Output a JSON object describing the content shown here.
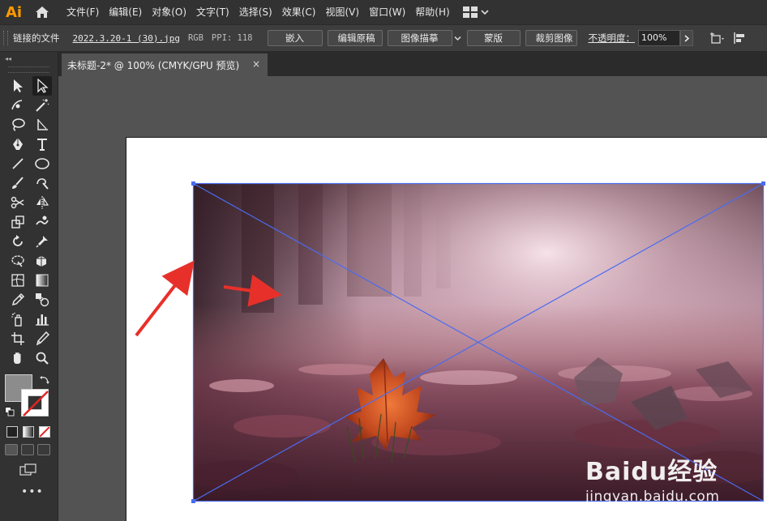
{
  "app": {
    "logo_text": "Ai",
    "accent_color": "#FF9A00"
  },
  "menu": {
    "items": [
      {
        "label": "文件(F)"
      },
      {
        "label": "编辑(E)"
      },
      {
        "label": "对象(O)"
      },
      {
        "label": "文字(T)"
      },
      {
        "label": "选择(S)"
      },
      {
        "label": "效果(C)"
      },
      {
        "label": "视图(V)"
      },
      {
        "label": "窗口(W)"
      },
      {
        "label": "帮助(H)"
      }
    ]
  },
  "control_bar": {
    "linked_file_label": "链接的文件",
    "filename": "2022.3.20-1 (30).jpg",
    "color_mode": "RGB",
    "ppi": "PPI: 118",
    "embed_button": "嵌入",
    "edit_original_button": "编辑原稿",
    "image_trace_button": "图像描摹",
    "mask_button": "蒙版",
    "crop_image_button": "裁剪图像",
    "opacity_label": "不透明度：",
    "opacity_value": "100%"
  },
  "document_tab": {
    "title": "未标题-2* @ 100% (CMYK/GPU 预览)",
    "close_symbol": "×"
  },
  "toolbar": {
    "collapse_symbol": "◂◂",
    "more_symbol": "•••",
    "fill_color": "#8c8c8c",
    "stroke_color": "#ffffff"
  },
  "canvas": {
    "selection_color": "#4a6cf0",
    "arrow_color": "#e8302a"
  },
  "watermark": {
    "brand": "Baidu经验",
    "url": "jingyan.baidu.com"
  }
}
